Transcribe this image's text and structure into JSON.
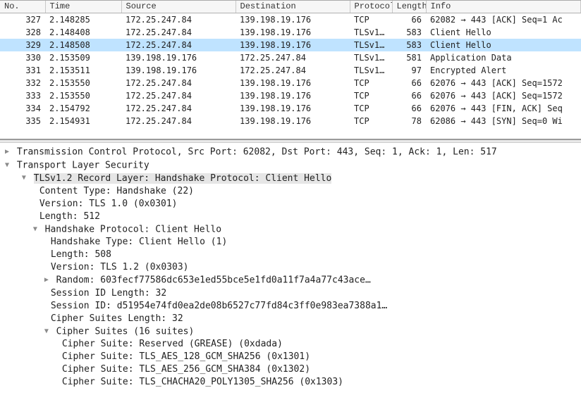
{
  "columns": {
    "no": "No.",
    "time": "Time",
    "source": "Source",
    "destination": "Destination",
    "protocol": "Protocol",
    "length": "Length",
    "info": "Info"
  },
  "packets": [
    {
      "no": "327",
      "time": "2.148285",
      "src": "172.25.247.84",
      "dst": "139.198.19.176",
      "proto": "TCP",
      "len": "66",
      "info": "62082 → 443 [ACK] Seq=1 Ac"
    },
    {
      "no": "328",
      "time": "2.148408",
      "src": "172.25.247.84",
      "dst": "139.198.19.176",
      "proto": "TLSv1…",
      "len": "583",
      "info": "Client Hello"
    },
    {
      "no": "329",
      "time": "2.148508",
      "src": "172.25.247.84",
      "dst": "139.198.19.176",
      "proto": "TLSv1…",
      "len": "583",
      "info": "Client Hello",
      "selected": true
    },
    {
      "no": "330",
      "time": "2.153509",
      "src": "139.198.19.176",
      "dst": "172.25.247.84",
      "proto": "TLSv1…",
      "len": "581",
      "info": "Application Data"
    },
    {
      "no": "331",
      "time": "2.153511",
      "src": "139.198.19.176",
      "dst": "172.25.247.84",
      "proto": "TLSv1…",
      "len": "97",
      "info": "Encrypted Alert"
    },
    {
      "no": "332",
      "time": "2.153550",
      "src": "172.25.247.84",
      "dst": "139.198.19.176",
      "proto": "TCP",
      "len": "66",
      "info": "62076 → 443 [ACK] Seq=1572"
    },
    {
      "no": "333",
      "time": "2.153550",
      "src": "172.25.247.84",
      "dst": "139.198.19.176",
      "proto": "TCP",
      "len": "66",
      "info": "62076 → 443 [ACK] Seq=1572"
    },
    {
      "no": "334",
      "time": "2.154792",
      "src": "172.25.247.84",
      "dst": "139.198.19.176",
      "proto": "TCP",
      "len": "66",
      "info": "62076 → 443 [FIN, ACK] Seq"
    },
    {
      "no": "335",
      "time": "2.154931",
      "src": "172.25.247.84",
      "dst": "139.198.19.176",
      "proto": "TCP",
      "len": "78",
      "info": "62086 → 443 [SYN] Seq=0 Wi"
    }
  ],
  "detail": {
    "tcp_line": "Transmission Control Protocol, Src Port: 62082, Dst Port: 443, Seq: 1, Ack: 1, Len: 517",
    "tls_line": "Transport Layer Security",
    "record_line": "TLSv1.2 Record Layer: Handshake Protocol: Client Hello",
    "content_type": "Content Type: Handshake (22)",
    "version_rec": "Version: TLS 1.0 (0x0301)",
    "length_rec": "Length: 512",
    "handshake_hdr": "Handshake Protocol: Client Hello",
    "handshake_type": "Handshake Type: Client Hello (1)",
    "length_hs": "Length: 508",
    "version_hs": "Version: TLS 1.2 (0x0303)",
    "random": "Random: 603fecf77586dc653e1ed55bce5e1fd0a11f7a4a77c43ace…",
    "sid_len": "Session ID Length: 32",
    "sid": "Session ID: d51954e74fd0ea2de08b6527c77fd84c3ff0e983ea7388a1…",
    "cs_len": "Cipher Suites Length: 32",
    "cs_hdr": "Cipher Suites (16 suites)",
    "cs1": "Cipher Suite: Reserved (GREASE) (0xdada)",
    "cs2": "Cipher Suite: TLS_AES_128_GCM_SHA256 (0x1301)",
    "cs3": "Cipher Suite: TLS_AES_256_GCM_SHA384 (0x1302)",
    "cs4": "Cipher Suite: TLS_CHACHA20_POLY1305_SHA256 (0x1303)"
  }
}
